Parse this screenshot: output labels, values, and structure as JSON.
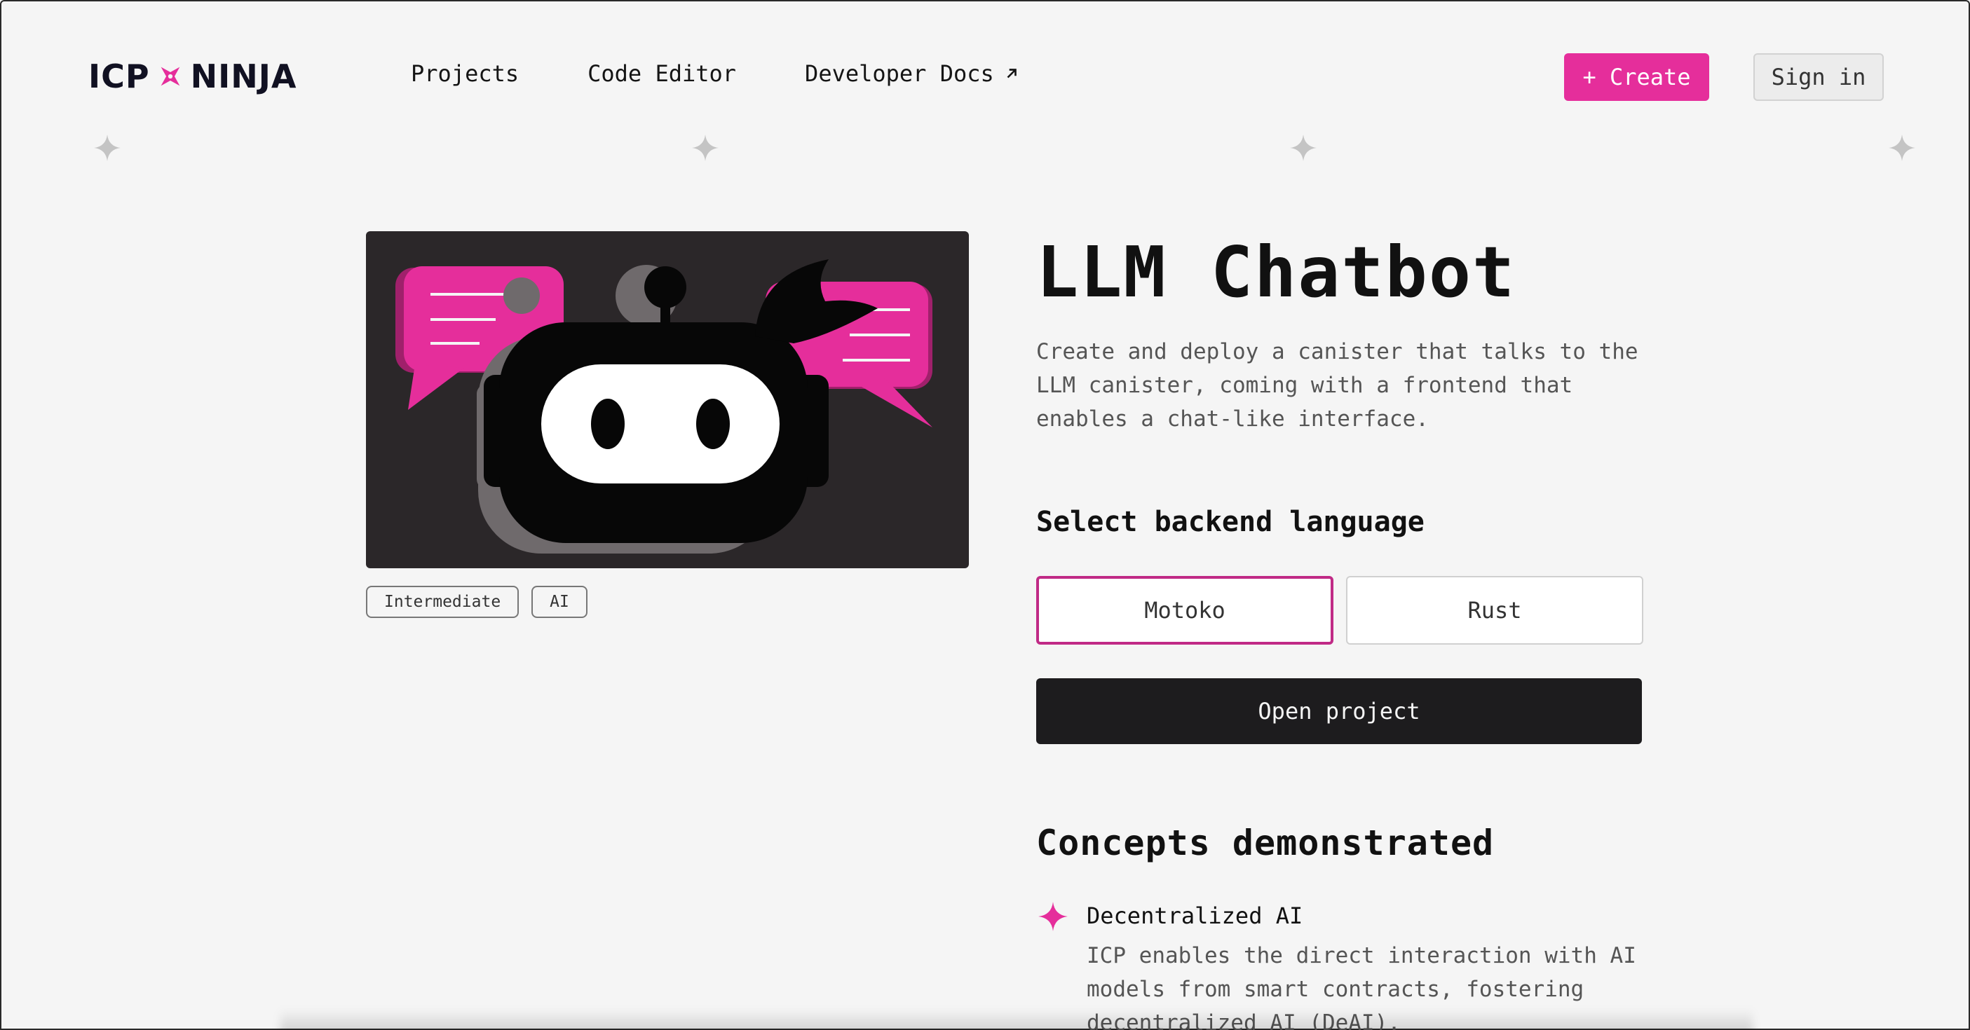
{
  "header": {
    "logo_left": "ICP",
    "logo_right": "NINJA",
    "nav": [
      {
        "label": "Projects"
      },
      {
        "label": "Code Editor"
      },
      {
        "label": "Developer Docs"
      }
    ],
    "create_label": "+ Create",
    "signin_label": "Sign in"
  },
  "project": {
    "title": "LLM Chatbot",
    "description": "Create and deploy a canister that talks to the LLM canister, coming with a frontend that enables a chat-like interface.",
    "tags": [
      "Intermediate",
      "AI"
    ],
    "select_heading": "Select backend language",
    "languages": [
      {
        "label": "Motoko",
        "selected": true
      },
      {
        "label": "Rust",
        "selected": false
      }
    ],
    "open_label": "Open project",
    "concepts_heading": "Concepts demonstrated",
    "concepts": [
      {
        "title": "Decentralized AI",
        "description": "ICP enables the direct interaction with AI models from smart contracts, fostering decentralized AI (DeAI)."
      }
    ]
  },
  "colors": {
    "accent": "#e52e9b",
    "dark": "#1d1c1e",
    "background": "#f5f5f5",
    "image_bg": "#2b2729"
  },
  "icons": [
    "ninja-star-icon",
    "external-link-arrow-icon",
    "sparkle-icon",
    "robot-ninja-illustration",
    "chat-bubble-icon"
  ]
}
